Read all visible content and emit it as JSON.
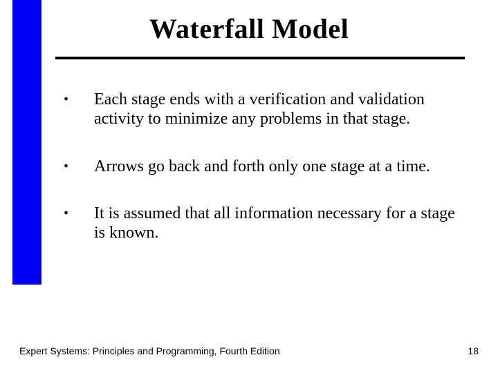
{
  "title": "Waterfall Model",
  "bullets": [
    "Each stage ends with a verification and validation activity to minimize any problems in that stage.",
    "Arrows go back and forth only one stage at a time.",
    "It is assumed that all information necessary for a stage is known."
  ],
  "footer": {
    "source": "Expert Systems: Principles and Programming, Fourth Edition",
    "page": "18"
  }
}
